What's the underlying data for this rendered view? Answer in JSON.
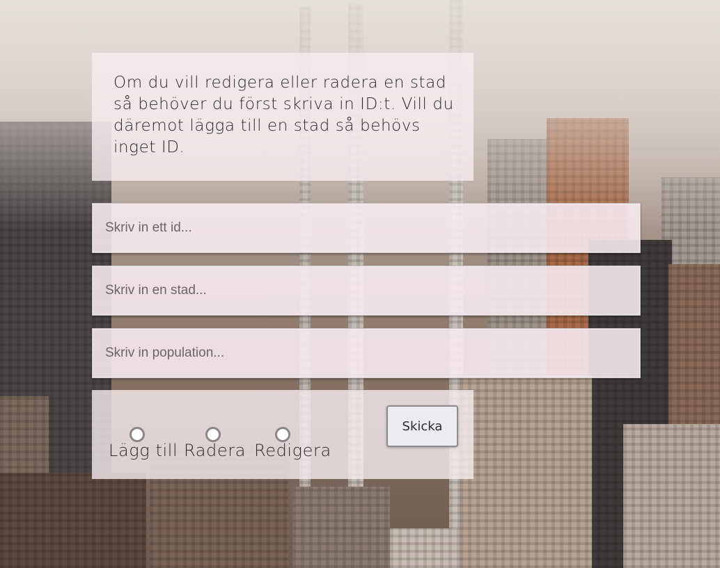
{
  "info": {
    "text": "Om du vill redigera eller radera en stad så behöver du först skriva in ID:t. Vill du däremot lägga till en stad så behövs inget ID."
  },
  "form": {
    "id_placeholder": "Skriv in ett id...",
    "city_placeholder": "Skriv in en stad...",
    "population_placeholder": "Skriv in population...",
    "id_value": "",
    "city_value": "",
    "population_value": ""
  },
  "actions": {
    "options": [
      {
        "label": "Lägg till",
        "selected": false
      },
      {
        "label": "Radera",
        "selected": false
      },
      {
        "label": "Redigera",
        "selected": false
      }
    ],
    "submit_label": "Skicka"
  },
  "colors": {
    "panel": "#f6eef0",
    "field": "#f9edf4",
    "text": "#2c2a2b",
    "radio_border": "#8b8588"
  }
}
